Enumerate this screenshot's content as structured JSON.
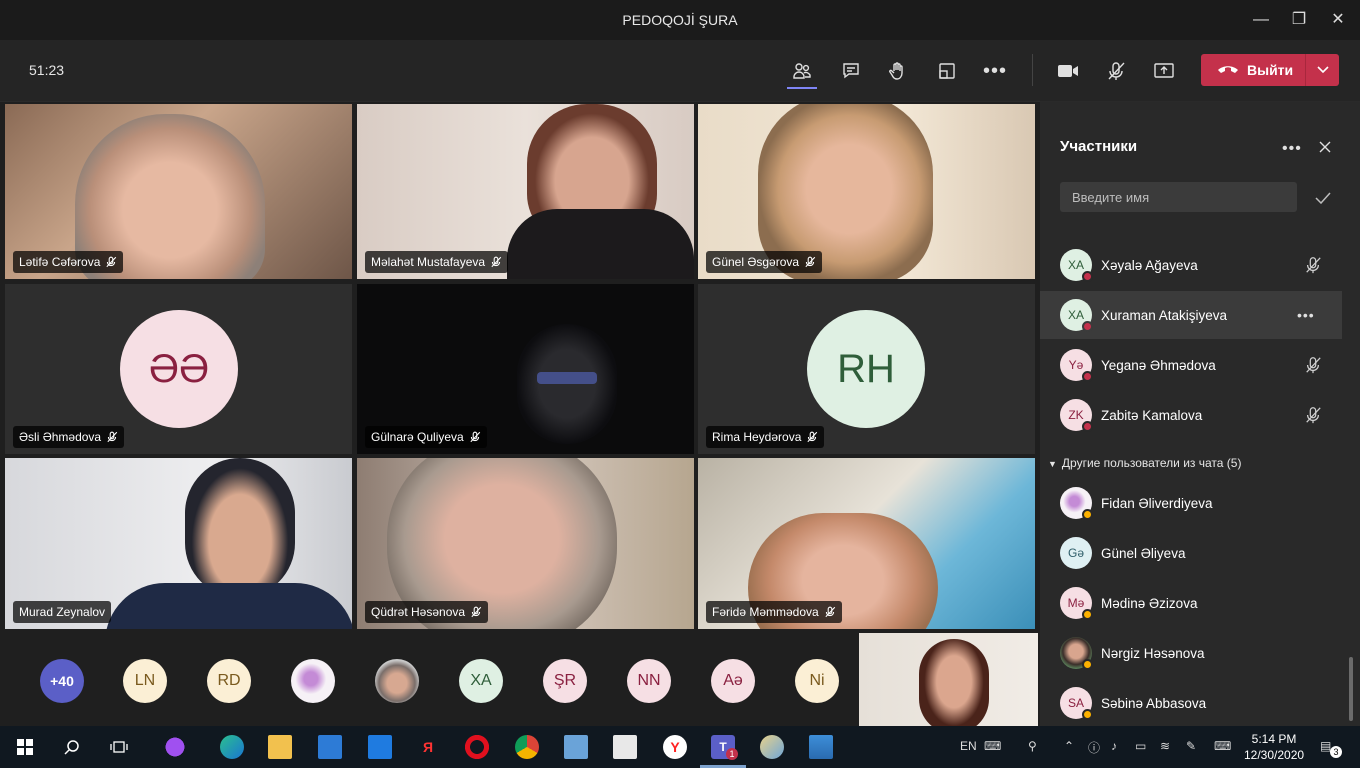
{
  "window": {
    "title": "PEDOQOJİ ŞURA",
    "minimize": "—",
    "maximize": "❐",
    "close": "✕"
  },
  "meeting": {
    "timer": "51:23",
    "leave_label": "Выйти"
  },
  "tiles": [
    {
      "name": "Lətifə Cəfərova"
    },
    {
      "name": "Məlahət Mustafayeva"
    },
    {
      "name": "Günel Əsgərova"
    },
    {
      "name": "Əsli Əhmədova",
      "initials": "ƏƏ"
    },
    {
      "name": "Gülnarə Quliyeva"
    },
    {
      "name": "Rima Heydərova",
      "initials": "RH"
    },
    {
      "name": "Murad Zeynalov"
    },
    {
      "name": "Qüdrət Həsənova"
    },
    {
      "name": "Fəridə Məmmədova"
    }
  ],
  "strip": {
    "overflow": "+40",
    "avatars": [
      "LN",
      "RD",
      "",
      "",
      "XA",
      "ŞR",
      "NN",
      "Aə",
      "Ni"
    ]
  },
  "panel": {
    "title": "Участники",
    "search_placeholder": "Введите имя",
    "participants": [
      {
        "initials": "XA",
        "name": "Xəyalə Ağayeva"
      },
      {
        "initials": "XA",
        "name": "Xuraman Atakişiyeva"
      },
      {
        "initials": "Yə",
        "name": "Yeganə Əhmədova"
      },
      {
        "initials": "ZK",
        "name": "Zabitə Kamalova"
      }
    ],
    "others_section": "Другие пользователи из чата (5)",
    "others": [
      {
        "initials": "",
        "name": "Fidan Əliverdiyeva"
      },
      {
        "initials": "Gə",
        "name": "Günel Əliyeva"
      },
      {
        "initials": "Mə",
        "name": "Mədinə Əzizova"
      },
      {
        "initials": "",
        "name": "Nərgiz Həsənova"
      },
      {
        "initials": "SA",
        "name": "Səbinə Abbasova"
      }
    ]
  },
  "taskbar": {
    "lang": "EN",
    "time": "5:14 PM",
    "date": "12/30/2020",
    "notifications": "3",
    "teams_badge": "1"
  },
  "colors": {
    "leave": "#c4314b",
    "accent": "#6264a7",
    "avatar_pink": "#f6dfe4",
    "avatar_green": "#dff0e3",
    "avatar_cream": "#fbefd5",
    "busy": "#c4314b",
    "away": "#fcb100"
  }
}
